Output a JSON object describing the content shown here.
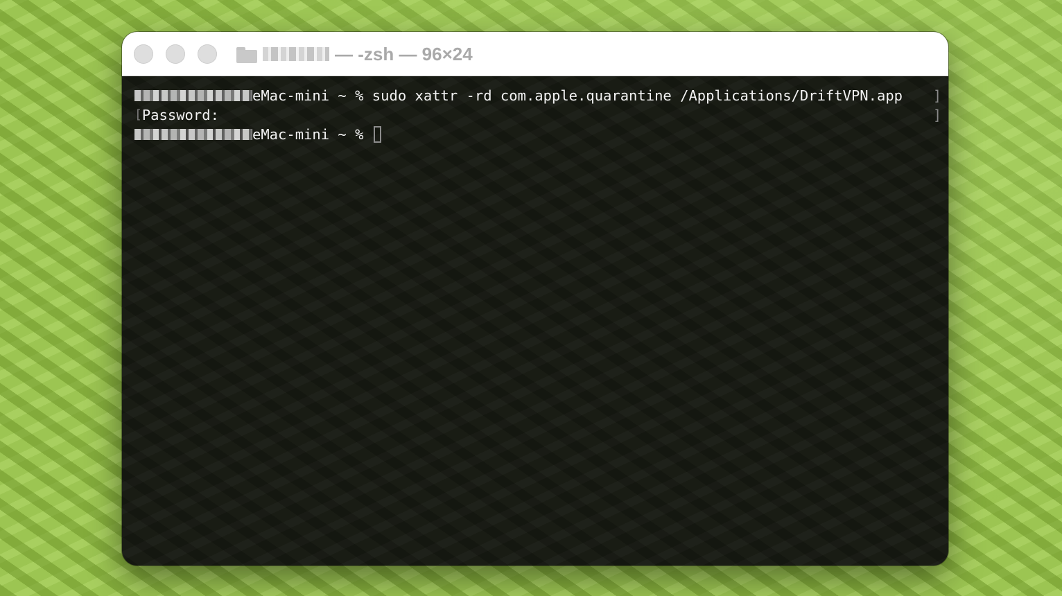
{
  "window": {
    "title": "— -zsh — 96×24"
  },
  "terminal": {
    "prompt_host": "eMac-mini ~ % ",
    "command": "sudo xattr -rd com.apple.quarantine /Applications/DriftVPN.app",
    "password_prompt": "Password:",
    "second_prompt_host": "eMac-mini ~ % "
  },
  "icons": {
    "traffic_lights": [
      "close-button",
      "minimize-button",
      "zoom-button"
    ],
    "title_icon": "folder-icon"
  },
  "colors": {
    "terminal_text": "#f2f2f2",
    "terminal_background": "#191c14",
    "titlebar_background": "#ffffff",
    "title_text": "#a9a9a9"
  }
}
